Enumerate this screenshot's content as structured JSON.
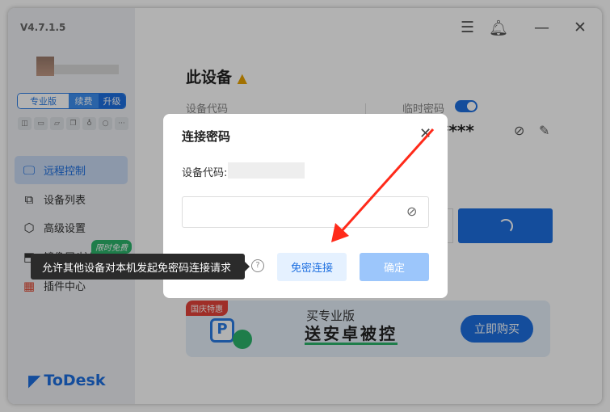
{
  "app": {
    "version": "V4.7.1.5",
    "logo": "ToDesk"
  },
  "sidebar": {
    "plan": "专业版",
    "renew": "续费",
    "upgrade": "升级",
    "items": [
      {
        "label": "远程控制",
        "icon": "monitor-icon"
      },
      {
        "label": "设备列表",
        "icon": "devices-icon"
      },
      {
        "label": "高级设置",
        "icon": "hexagon-settings-icon"
      },
      {
        "label": "镜像屏/扩展屏",
        "icon": "mirror-screen-icon"
      },
      {
        "label": "插件中心",
        "icon": "plugins-icon"
      }
    ],
    "free_badge": "限时免费"
  },
  "main": {
    "title": "此设备",
    "device_code_label": "设备代码",
    "temp_password_label": "临时密码",
    "temp_password_enabled": true,
    "password_mask": "****",
    "banner": {
      "tag": "国庆特惠",
      "line1": "买专业版",
      "line2": "送安卓被控",
      "button": "立即购买"
    }
  },
  "dialog": {
    "title": "连接密码",
    "device_code_label": "设备代码:",
    "password_value": "",
    "free_connect": "免密连接",
    "confirm": "确定"
  },
  "tooltip": {
    "text": "允许其他设备对本机发起免密码连接请求"
  },
  "colors": {
    "accent": "#1d6fe0",
    "arrow": "#ff2a1a"
  }
}
